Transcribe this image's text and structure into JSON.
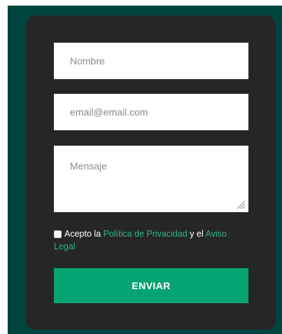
{
  "form": {
    "name_placeholder": "Nombre",
    "email_placeholder": "email@email.com",
    "message_placeholder": "Mensaje",
    "consent": {
      "checked": false,
      "prefix": "Acepto la ",
      "privacy_link": "Política de Privacidad",
      "middle": " y el ",
      "legal_link": "Aviso Legal"
    },
    "submit_label": "ENVIAR"
  },
  "colors": {
    "page_background": "#01443f",
    "card_background": "#262626",
    "accent": "#06a473",
    "link": "#2bb48a"
  }
}
